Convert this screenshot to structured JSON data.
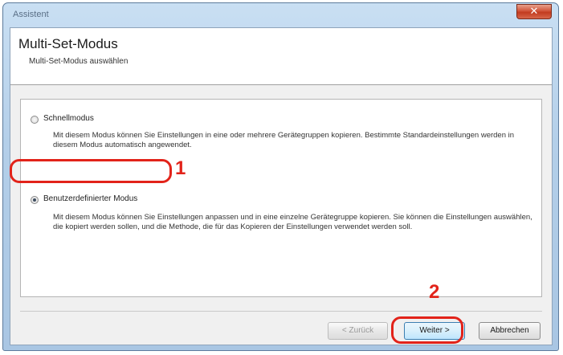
{
  "window": {
    "title": "Assistent",
    "close_glyph": "✕"
  },
  "header": {
    "title": "Multi-Set-Modus",
    "subtitle": "Multi-Set-Modus auswählen"
  },
  "options": [
    {
      "label": "Schnellmodus",
      "selected": false,
      "description": "Mit diesem Modus können Sie Einstellungen in eine oder mehrere Gerätegruppen kopieren. Bestimmte Standardeinstellungen werden in diesem Modus automatisch angewendet."
    },
    {
      "label": "Benutzerdefinierter Modus",
      "selected": true,
      "description": "Mit diesem Modus können Sie Einstellungen anpassen und in eine einzelne Gerätegruppe kopieren. Sie können die Einstellungen auswählen, die kopiert werden sollen, und die Methode, die für das Kopieren der Einstellungen verwendet werden soll."
    }
  ],
  "callouts": {
    "step1": "1",
    "step2": "2"
  },
  "buttons": {
    "back": "< Zurück",
    "next": "Weiter >",
    "cancel": "Abbrechen"
  },
  "colors": {
    "callout_red": "#e2231a",
    "title_bar": "#b4cfe9"
  },
  "icons": {
    "close": "close-icon",
    "radio": "radio-button"
  }
}
